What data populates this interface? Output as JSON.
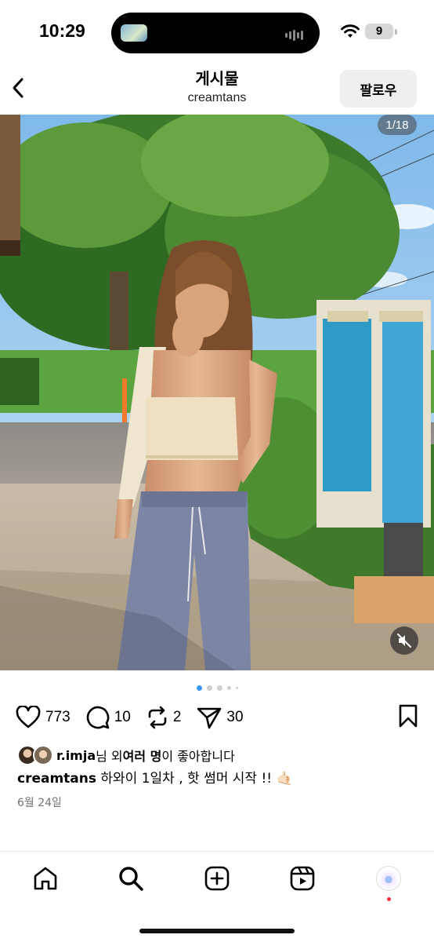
{
  "status_bar": {
    "time": "10:29",
    "battery": "9"
  },
  "header": {
    "title": "게시물",
    "subtitle": "creamtans",
    "follow_label": "팔로우"
  },
  "photo": {
    "counter": "1/18",
    "dots_count": 5,
    "active_dot": 0
  },
  "actions": {
    "likes": "773",
    "comments": "10",
    "reposts": "2",
    "shares": "30"
  },
  "likes_line": {
    "user": "r.imja",
    "text_mid": "님 외 ",
    "others": "여러 명",
    "text_end": "이 좋아합니다"
  },
  "caption": {
    "user": "creamtans",
    "text": " 하와이 1일차 , 핫 썸머 시작 !! 🤙🏻"
  },
  "date": "6월 24일",
  "next_post": {
    "user": "creamtans"
  },
  "colors": {
    "accent": "#3797f0",
    "notification": "#ff3040"
  },
  "nav": {
    "items": [
      "home-icon",
      "search-icon",
      "create-icon",
      "reels-icon",
      "profile-avatar"
    ]
  }
}
